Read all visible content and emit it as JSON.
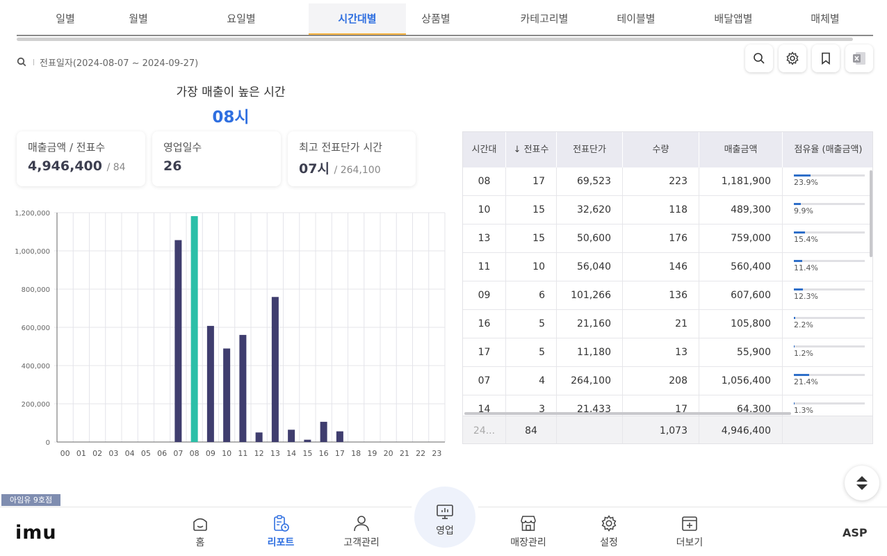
{
  "tabs": [
    {
      "label": "일별"
    },
    {
      "label": "월별"
    },
    {
      "label": "요일별"
    },
    {
      "label": "시간대별"
    },
    {
      "label": "상품별"
    },
    {
      "label": "카테고리별"
    },
    {
      "label": "테이블별"
    },
    {
      "label": "배달앱별"
    },
    {
      "label": "매체별"
    }
  ],
  "active_tab": "시간대별",
  "filter": {
    "text": "전표일자(2024-08-07 ~ 2024-09-27)"
  },
  "toolbar_icons": [
    "search-icon",
    "gear-icon",
    "bookmark-icon",
    "excel-icon"
  ],
  "headline": {
    "label": "가장 매출이 높은 시간",
    "value": "08시"
  },
  "cards": [
    {
      "label": "매출금액 / 전표수",
      "value": "4,946,400",
      "sub": "/ 84"
    },
    {
      "label": "영업일수",
      "value": "26",
      "sub": ""
    },
    {
      "label": "최고 전표단가 시간",
      "value": "07시",
      "sub": "/ 264,100"
    }
  ],
  "chart_data": {
    "type": "bar",
    "categories": [
      "00",
      "01",
      "02",
      "03",
      "04",
      "05",
      "06",
      "07",
      "08",
      "09",
      "10",
      "11",
      "12",
      "13",
      "14",
      "15",
      "16",
      "17",
      "18",
      "19",
      "20",
      "21",
      "22",
      "23"
    ],
    "values": [
      0,
      0,
      0,
      0,
      0,
      0,
      0,
      1056400,
      1181900,
      607600,
      489300,
      560400,
      50000,
      759000,
      64300,
      12000,
      105800,
      55900,
      0,
      0,
      0,
      0,
      0,
      0
    ],
    "highlight_category": "08",
    "ylim": [
      0,
      1200000
    ],
    "yticks": [
      "0",
      "200,000",
      "400,000",
      "600,000",
      "800,000",
      "1,000,000",
      "1,200,000"
    ],
    "ytick_values": [
      0,
      200000,
      400000,
      600000,
      800000,
      1000000,
      1200000
    ],
    "colors": {
      "bar": "#3f3d6e",
      "highlight": "#2bbfa8",
      "grid": "#e4e4ea"
    },
    "grid": true
  },
  "table": {
    "headers": [
      "시간대",
      "↓ 전표수",
      "전표단가",
      "수량",
      "매출금액",
      "점유율 (매출금액)"
    ],
    "rows": [
      {
        "hour": "08",
        "count": "17",
        "unit": "69,523",
        "qty": "223",
        "amount": "1,181,900",
        "share": "23.9%",
        "share_value": 23.9
      },
      {
        "hour": "10",
        "count": "15",
        "unit": "32,620",
        "qty": "118",
        "amount": "489,300",
        "share": "9.9%",
        "share_value": 9.9
      },
      {
        "hour": "13",
        "count": "15",
        "unit": "50,600",
        "qty": "176",
        "amount": "759,000",
        "share": "15.4%",
        "share_value": 15.4
      },
      {
        "hour": "11",
        "count": "10",
        "unit": "56,040",
        "qty": "146",
        "amount": "560,400",
        "share": "11.4%",
        "share_value": 11.4
      },
      {
        "hour": "09",
        "count": "6",
        "unit": "101,266",
        "qty": "136",
        "amount": "607,600",
        "share": "12.3%",
        "share_value": 12.3
      },
      {
        "hour": "16",
        "count": "5",
        "unit": "21,160",
        "qty": "21",
        "amount": "105,800",
        "share": "2.2%",
        "share_value": 2.2
      },
      {
        "hour": "17",
        "count": "5",
        "unit": "11,180",
        "qty": "13",
        "amount": "55,900",
        "share": "1.2%",
        "share_value": 1.2
      },
      {
        "hour": "07",
        "count": "4",
        "unit": "264,100",
        "qty": "208",
        "amount": "1,056,400",
        "share": "21.4%",
        "share_value": 21.4
      },
      {
        "hour": "14",
        "count": "3",
        "unit": "21,433",
        "qty": "17",
        "amount": "64,300",
        "share": "1.3%",
        "share_value": 1.3
      }
    ],
    "footer": {
      "hour": "24...",
      "count": "84",
      "unit": "",
      "qty": "1,073",
      "amount": "4,946,400",
      "share": ""
    }
  },
  "badge": "아임유 9호점",
  "bottom_nav": {
    "logo": "imu",
    "items": [
      {
        "label": "홈",
        "icon": "home-icon"
      },
      {
        "label": "리포트",
        "icon": "report-icon"
      },
      {
        "label": "고객관리",
        "icon": "customer-icon"
      },
      {
        "label": "영업",
        "icon": "sales-icon"
      },
      {
        "label": "매장관리",
        "icon": "store-icon"
      },
      {
        "label": "설정",
        "icon": "settings-icon"
      },
      {
        "label": "더보기",
        "icon": "more-icon"
      }
    ],
    "active": "리포트",
    "right_label": "ASP"
  }
}
